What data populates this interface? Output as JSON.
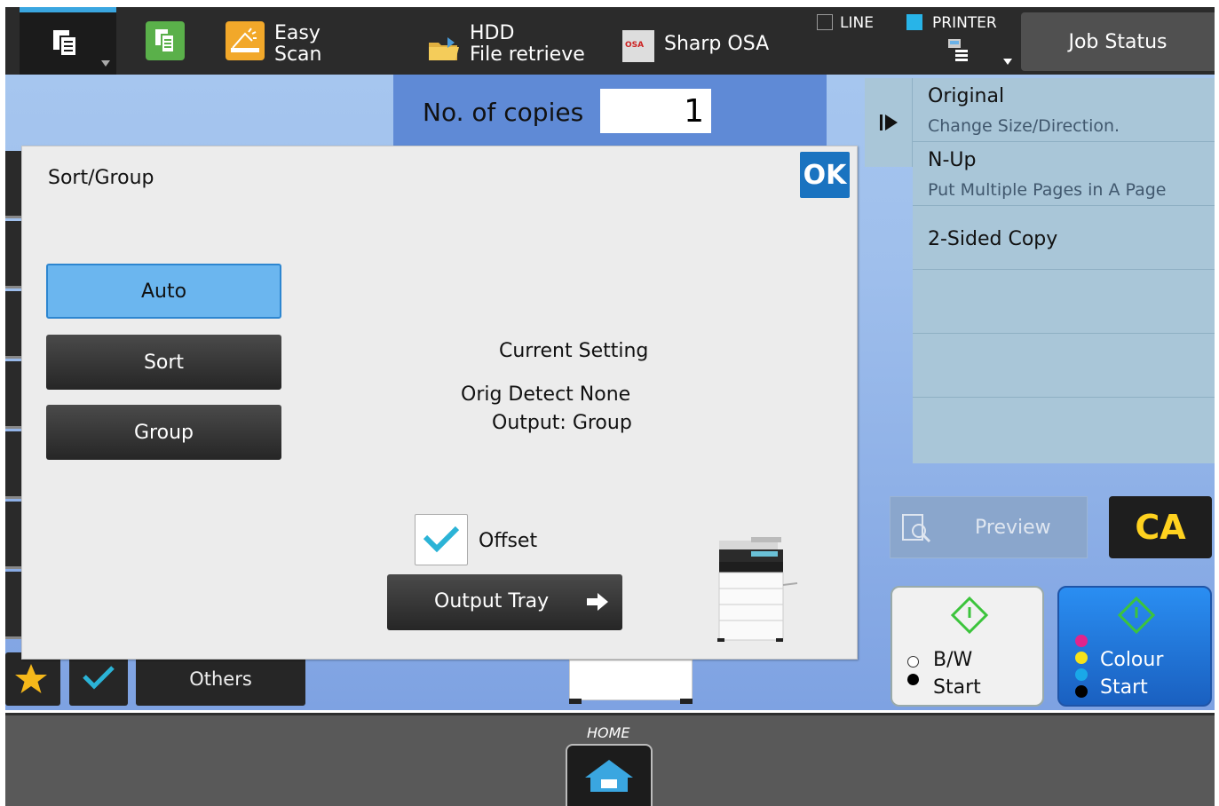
{
  "topbar": {
    "easy_scan_line1": "Easy",
    "easy_scan_line2": "Scan",
    "hdd_line1": "HDD",
    "hdd_line2": "File retrieve",
    "sharp_osa": "Sharp OSA",
    "line": "LINE",
    "printer": "PRINTER",
    "job_status": "Job Status"
  },
  "copies": {
    "label": "No. of copies",
    "value": "1"
  },
  "right_panel": {
    "items": [
      {
        "title": "Original",
        "subtitle": "Change Size/Direction."
      },
      {
        "title": "N-Up",
        "subtitle": "Put Multiple Pages in A Page"
      },
      {
        "title": "2-Sided Copy",
        "subtitle": ""
      }
    ],
    "preview": "Preview",
    "ca": "CA",
    "bw_line1": "B/W",
    "bw_line2": "Start",
    "colour_line1": "Colour",
    "colour_line2": "Start"
  },
  "bottom_left": {
    "others": "Others"
  },
  "dialog": {
    "title": "Sort/Group",
    "ok": "OK",
    "options": [
      "Auto",
      "Sort",
      "Group"
    ],
    "selected": "Auto",
    "current_setting_label": "Current Setting",
    "orig_detect": "Orig Detect None",
    "output": "Output: Group",
    "offset_label": "Offset",
    "offset_checked": true,
    "output_tray": "Output Tray"
  },
  "home": {
    "label": "HOME"
  },
  "colors": {
    "accent_blue": "#1a73c0",
    "selected_option": "#6bb6ef",
    "check_teal": "#2bb3d6",
    "ca_yellow": "#ffd21f"
  }
}
